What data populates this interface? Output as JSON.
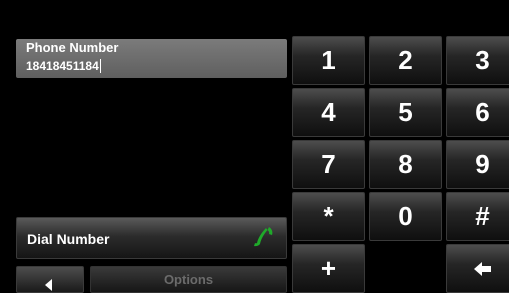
{
  "display": {
    "label": "Phone Number",
    "value": "18418451184"
  },
  "keypad": {
    "keys": [
      "1",
      "2",
      "3",
      "4",
      "5",
      "6",
      "7",
      "8",
      "9",
      "*",
      "0",
      "#",
      "+"
    ],
    "backspace_icon": "backspace-arrow-icon"
  },
  "dial": {
    "label": "Dial Number",
    "icon": "phone-icon",
    "icon_color": "#1faa2a"
  },
  "footer": {
    "back_icon": "back-arrow-icon",
    "options_label": "Options"
  }
}
